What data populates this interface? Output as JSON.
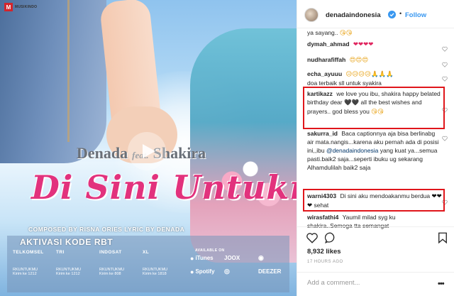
{
  "media": {
    "logo_text": "MUSIKINDO",
    "artist_a": "Denada",
    "artist_feat": "feat.",
    "artist_b": "Shakira",
    "song_title": "Di Sini Untukmu",
    "credits": "COMPOSED BY RISNA ORIES LYRIC BY DENADA",
    "rbt_title": "AKTIVASI KODE RBT",
    "carriers": [
      {
        "name": "TELKOMSEL",
        "code": "RKUNTUKMU",
        "kirim": "Kirim ke 1212"
      },
      {
        "name": "TRI",
        "code": "RKUNTUKMU",
        "kirim": "Kirim ke 1212"
      },
      {
        "name": "INDOSAT",
        "code": "RKUNTUKMU",
        "kirim": "Kirim ke 808"
      },
      {
        "name": "XL",
        "code": "RKUNTUKMU",
        "kirim": "Kirim ke 1818"
      }
    ],
    "available_on": "AVAILABLE ON",
    "stores": [
      {
        "name": "iTunes",
        "glyph": ""
      },
      {
        "name": "JOOX",
        "glyph": ""
      },
      {
        "name": "",
        "glyph": "◉"
      },
      {
        "name": "Spotify",
        "glyph": "●"
      },
      {
        "name": "",
        "glyph": "◎"
      },
      {
        "name": "DEEZER",
        "glyph": ""
      }
    ]
  },
  "header": {
    "username": "denadaindonesia",
    "separator": "•",
    "follow_label": "Follow"
  },
  "comments": [
    {
      "user": "",
      "text": "ya sayang..",
      "emoji": "😘😘"
    },
    {
      "user": "dymah_ahmad",
      "text": "",
      "emoji": "❤❤❤❤"
    },
    {
      "user": "nudharafiffah",
      "text": "",
      "emoji": "😍😍😍"
    },
    {
      "user": "echa_ayuuu",
      "text": "",
      "emoji": "😥😥😥😥🙏🙏🙏"
    },
    {
      "user": "",
      "text": "doa terbaik sll untuk syakira",
      "emoji": ""
    },
    {
      "user": "kartikazz",
      "text": "we love you ibu, shakira happy belated birthday dear",
      "emoji": "🖤🖤",
      "text2": "all the best wishes and prayers.. god bless you",
      "emoji2": "😘😘"
    },
    {
      "user": "sakurra_id",
      "text": "Baca captionnya aja bisa berlinabg air mata.nangis...karena aku pernah ada di posisi ini,,ibu",
      "mention": "@denadaindonesia",
      "text2": "yang kuat ya...semua pasti.baik2 saja...seperti ibuku ug sekarang Alhamdulilah baik2 saja"
    },
    {
      "user": "warni4303",
      "text": "Di sini aku mendoakanmu berdua",
      "emoji": "❤❤❤",
      "text2": "sehat"
    },
    {
      "user": "wirasfathi4",
      "text": "Yaumil milad syg ku shakira..Semoga tta semangat",
      "emoji": ""
    }
  ],
  "likes": "8,932 likes",
  "timestamp": "17 HOURS AGO",
  "add_comment_placeholder": "Add a comment...",
  "more_label": "•••",
  "colors": {
    "accent": "#3897f0",
    "highlight_box": "#e0161b",
    "title_pink": "#e2327d"
  }
}
